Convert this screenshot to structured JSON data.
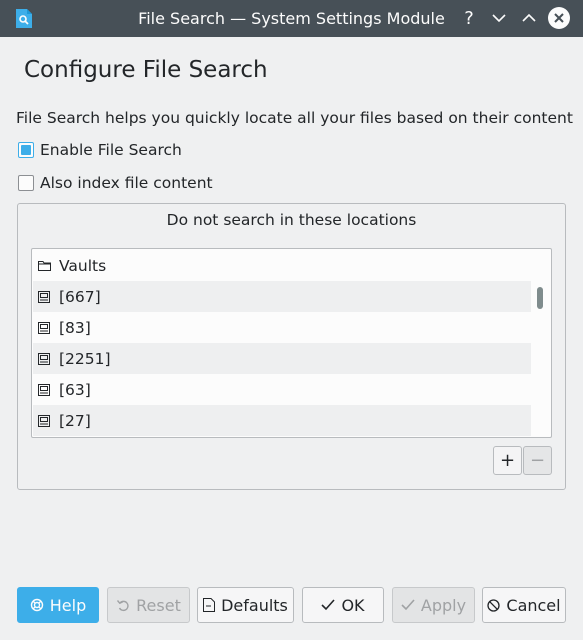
{
  "window": {
    "title": "File Search — System Settings Module",
    "help_glyph": "?",
    "min_glyph": "∨",
    "max_glyph": "∧",
    "close_glyph": "✕"
  },
  "page": {
    "title": "Configure File Search",
    "description": "File Search helps you quickly locate all your files based on their content"
  },
  "options": {
    "enable_label": "Enable File Search",
    "enable_checked": true,
    "index_content_label": "Also index file content",
    "index_content_checked": false
  },
  "exclusions": {
    "title": "Do not search in these locations",
    "items": [
      {
        "label": "Vaults",
        "icon": "folder-icon"
      },
      {
        "label": "[667]",
        "icon": "drive-icon"
      },
      {
        "label": "[83]",
        "icon": "drive-icon"
      },
      {
        "label": "[2251]",
        "icon": "drive-icon"
      },
      {
        "label": "[63]",
        "icon": "drive-icon"
      },
      {
        "label": "[27]",
        "icon": "drive-icon"
      }
    ],
    "add_glyph": "+",
    "remove_glyph": "−"
  },
  "footer": {
    "help_label": "Help",
    "reset_label": "Reset",
    "defaults_label": "Defaults",
    "ok_label": "OK",
    "apply_label": "Apply",
    "cancel_label": "Cancel"
  },
  "colors": {
    "titlebar": "#475057",
    "accent": "#3daee9",
    "background": "#eff0f1"
  }
}
